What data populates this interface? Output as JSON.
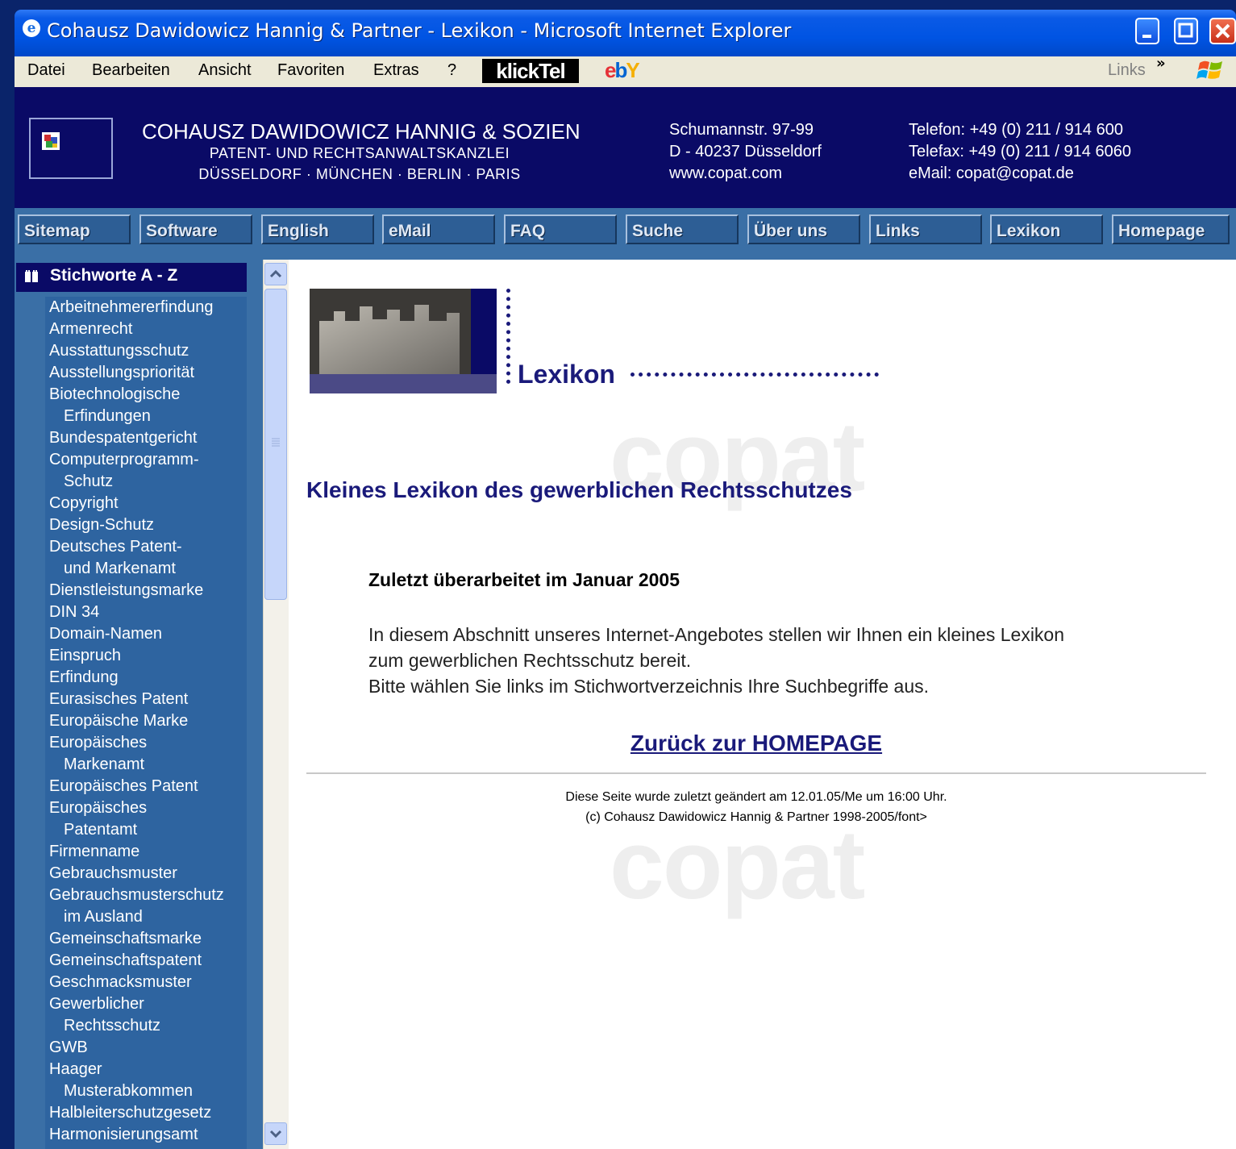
{
  "window": {
    "title": "Cohausz Dawidowicz Hannig & Partner - Lexikon - Microsoft Internet Explorer",
    "ie_icon_glyph": "e"
  },
  "menubar": {
    "items": [
      "Datei",
      "Bearbeiten",
      "Ansicht",
      "Favoriten",
      "Extras",
      "?"
    ],
    "klicktel": "klickTel",
    "ebay": [
      "e",
      "b",
      "Y"
    ],
    "links_label": "Links",
    "chevron": "»"
  },
  "header": {
    "firm_name": "COHAUSZ DAWIDOWICZ HANNIG & SOZIEN",
    "firm_subtitle": "PATENT- UND RECHTSANWALTSKANZLEI",
    "firm_cities": "DÜSSELDORF · MÜNCHEN · BERLIN · PARIS",
    "address": [
      "Schumannstr. 97-99",
      "D - 40237 Düsseldorf",
      "www.copat.com"
    ],
    "contact": [
      "Telefon: +49 (0) 211 / 914 600",
      "Telefax: +49 (0) 211 / 914 6060",
      "eMail: copat@copat.de"
    ]
  },
  "nav": {
    "tabs": [
      "Sitemap",
      "Software",
      "English",
      "eMail",
      "FAQ",
      "Suche",
      "Über uns",
      "Links",
      "Lexikon",
      "Homepage"
    ]
  },
  "sidebar": {
    "title": "Stichworte A - Z",
    "items": [
      "Arbeitnehmererfindung",
      "Armenrecht",
      "Ausstattungsschutz",
      "Ausstellungspriorität",
      "Biotechnologische",
      "Erfindungen",
      "Bundespatentgericht",
      "Computerprogramm-",
      "Schutz",
      "Copyright",
      "Design-Schutz",
      "Deutsches Patent-",
      "und Markenamt",
      "Dienstleistungsmarke",
      "DIN 34",
      "Domain-Namen",
      "Einspruch",
      "Erfindung",
      "Eurasisches Patent",
      "Europäische Marke",
      "Europäisches",
      "Markenamt",
      "Europäisches Patent",
      "Europäisches",
      "Patentamt",
      "Firmenname",
      "Gebrauchsmuster",
      "Gebrauchsmusterschutz",
      "im Ausland",
      "Gemeinschaftsmarke",
      "Gemeinschaftspatent",
      "Geschmacksmuster",
      "Gewerblicher",
      "Rechtsschutz",
      "GWB",
      "Haager",
      "Musterabkommen",
      "Halbleiterschutzgesetz",
      "Harmonisierungsamt"
    ]
  },
  "content": {
    "watermark": "copat",
    "banner_label": "Lexikon",
    "heading": "Kleines Lexikon des gewerblichen Rechtsschutzes",
    "revised": "Zuletzt überarbeitet im Januar 2005",
    "intro_lines": [
      "In diesem Abschnitt unseres Internet-Angebotes stellen wir Ihnen ein kleines Lexikon",
      "zum gewerblichen Rechtsschutz bereit.",
      "Bitte wählen Sie links im Stichwortverzeichnis Ihre Suchbegriffe aus."
    ],
    "homepage_link": "Zurück zur HOMEPAGE",
    "footer_lines": [
      "Diese Seite wurde zuletzt geändert am 12.01.05/Me um 16:00 Uhr.",
      "(c) Cohausz Dawidowicz Hannig & Partner 1998-2005/font>"
    ]
  },
  "colors": {
    "header_bg": "#0a0a66",
    "nav_bg": "#3a6fa6",
    "sidebar_list_bg": "#2e64a0",
    "heading_text": "#1a1a7a"
  }
}
